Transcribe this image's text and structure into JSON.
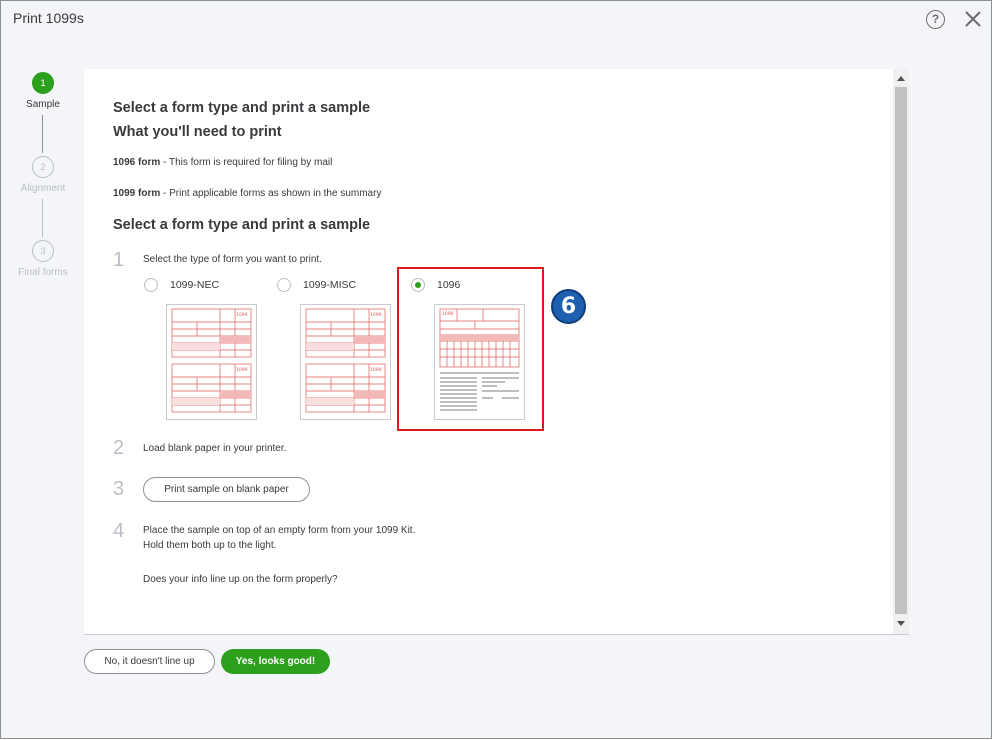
{
  "window": {
    "title": "Print 1099s"
  },
  "header": {
    "help_icon_glyph": "?",
    "close_icon": "close-icon"
  },
  "stepper": {
    "steps": [
      {
        "number": "1",
        "label": "Sample",
        "active": true
      },
      {
        "number": "2",
        "label": "Alignment",
        "active": false
      },
      {
        "number": "3",
        "label": "Final forms",
        "active": false
      }
    ]
  },
  "main": {
    "heading1": "Select a form type and print a sample",
    "heading2": "What you'll need to print",
    "form1096": {
      "bold": "1096 form",
      "text": " - This form is required for filing by mail"
    },
    "form1099": {
      "bold": "1099 form",
      "text": " - Print applicable forms as shown in the summary"
    },
    "heading3": "Select a form type and print a sample",
    "steps": [
      {
        "number": "1",
        "text": "Select the type of form you want to print."
      },
      {
        "number": "2",
        "text": "Load blank paper in your printer."
      },
      {
        "number": "3",
        "button": "Print sample on blank paper"
      },
      {
        "number": "4",
        "line1": "Place the sample on top of an empty form from your 1099 Kit.",
        "line2": "Hold them both up to the light.",
        "question": "Does your info line up on the form properly?"
      }
    ],
    "form_options": [
      {
        "label": "1099-NEC",
        "selected": false
      },
      {
        "label": "1099-MISC",
        "selected": false
      },
      {
        "label": "1096",
        "selected": true
      }
    ],
    "thumb_tag_1099": "1099",
    "thumb_tag_1096": "1096"
  },
  "annotation": {
    "badge": "6"
  },
  "footer": {
    "no_button": "No, it doesn't line up",
    "yes_button": "Yes, looks good!"
  },
  "colors": {
    "accent_green": "#2ca01c",
    "highlight_red": "#e0161e",
    "badge_blue": "#1f5fb0"
  }
}
